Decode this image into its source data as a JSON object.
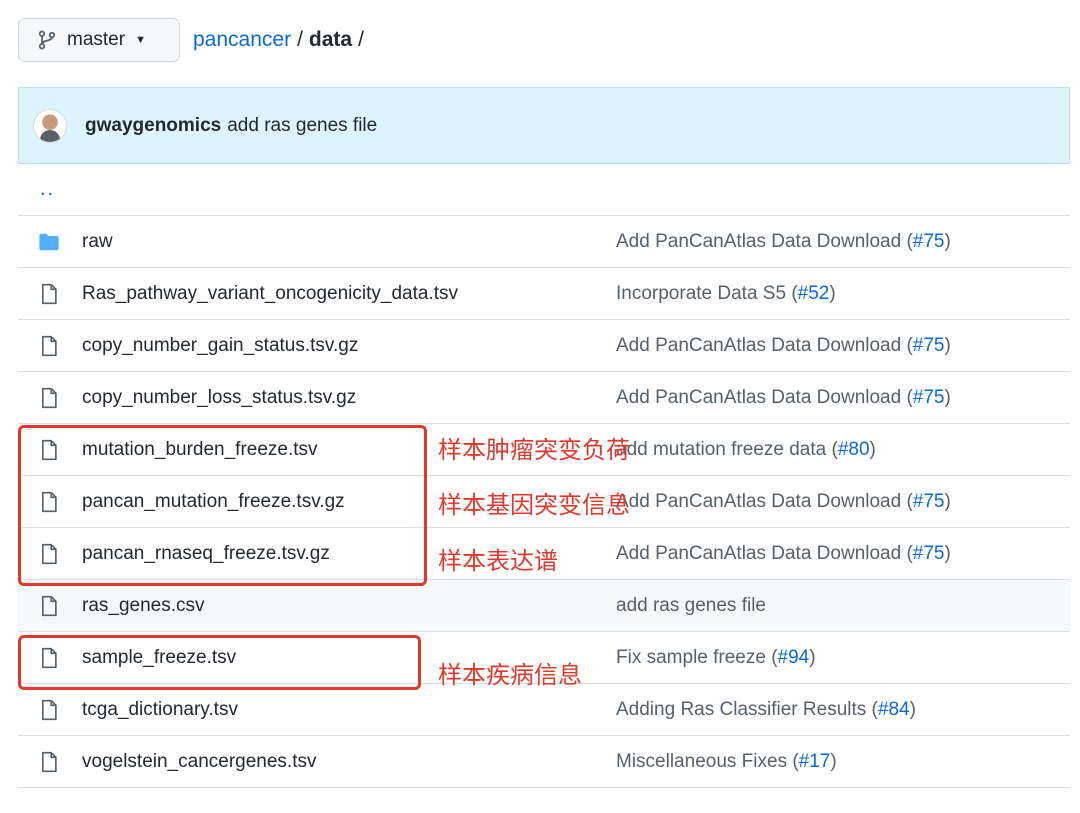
{
  "branch": {
    "label": "master"
  },
  "breadcrumb": {
    "repo": "pancancer",
    "sep1": "/",
    "folder": "data",
    "sep2": "/"
  },
  "commit": {
    "author": "gwaygenomics",
    "message": "add ras genes file"
  },
  "parent_dir": "..",
  "files": [
    {
      "name": "raw",
      "type": "folder",
      "msg": "Add PanCanAtlas Data Download (",
      "pr": "#75",
      "end": ")"
    },
    {
      "name": "Ras_pathway_variant_oncogenicity_data.tsv",
      "type": "file",
      "msg": "Incorporate Data S5 (",
      "pr": "#52",
      "end": ")"
    },
    {
      "name": "copy_number_gain_status.tsv.gz",
      "type": "file",
      "msg": "Add PanCanAtlas Data Download (",
      "pr": "#75",
      "end": ")"
    },
    {
      "name": "copy_number_loss_status.tsv.gz",
      "type": "file",
      "msg": "Add PanCanAtlas Data Download (",
      "pr": "#75",
      "end": ")"
    },
    {
      "name": "mutation_burden_freeze.tsv",
      "type": "file",
      "msg": "add mutation freeze data (",
      "pr": "#80",
      "end": ")"
    },
    {
      "name": "pancan_mutation_freeze.tsv.gz",
      "type": "file",
      "msg": "Add PanCanAtlas Data Download (",
      "pr": "#75",
      "end": ")"
    },
    {
      "name": "pancan_rnaseq_freeze.tsv.gz",
      "type": "file",
      "msg": "Add PanCanAtlas Data Download (",
      "pr": "#75",
      "end": ")"
    },
    {
      "name": "ras_genes.csv",
      "type": "file",
      "msg": "add ras genes file",
      "pr": "",
      "end": ""
    },
    {
      "name": "sample_freeze.tsv",
      "type": "file",
      "msg": "Fix sample freeze (",
      "pr": "#94",
      "end": ")"
    },
    {
      "name": "tcga_dictionary.tsv",
      "type": "file",
      "msg": "Adding Ras Classifier Results (",
      "pr": "#84",
      "end": ")"
    },
    {
      "name": "vogelstein_cancergenes.tsv",
      "type": "file",
      "msg": "Miscellaneous Fixes (",
      "pr": "#17",
      "end": ")"
    }
  ],
  "annotations": {
    "mutation_burden": "样本肿瘤突变负荷",
    "gene_mutation": "样本基因突变信息",
    "expression": "样本表达谱",
    "disease": "样本疾病信息"
  },
  "colors": {
    "accent": "#0969da",
    "annotation": "#e03a2c",
    "commit_bar": "#ddf4ff"
  }
}
